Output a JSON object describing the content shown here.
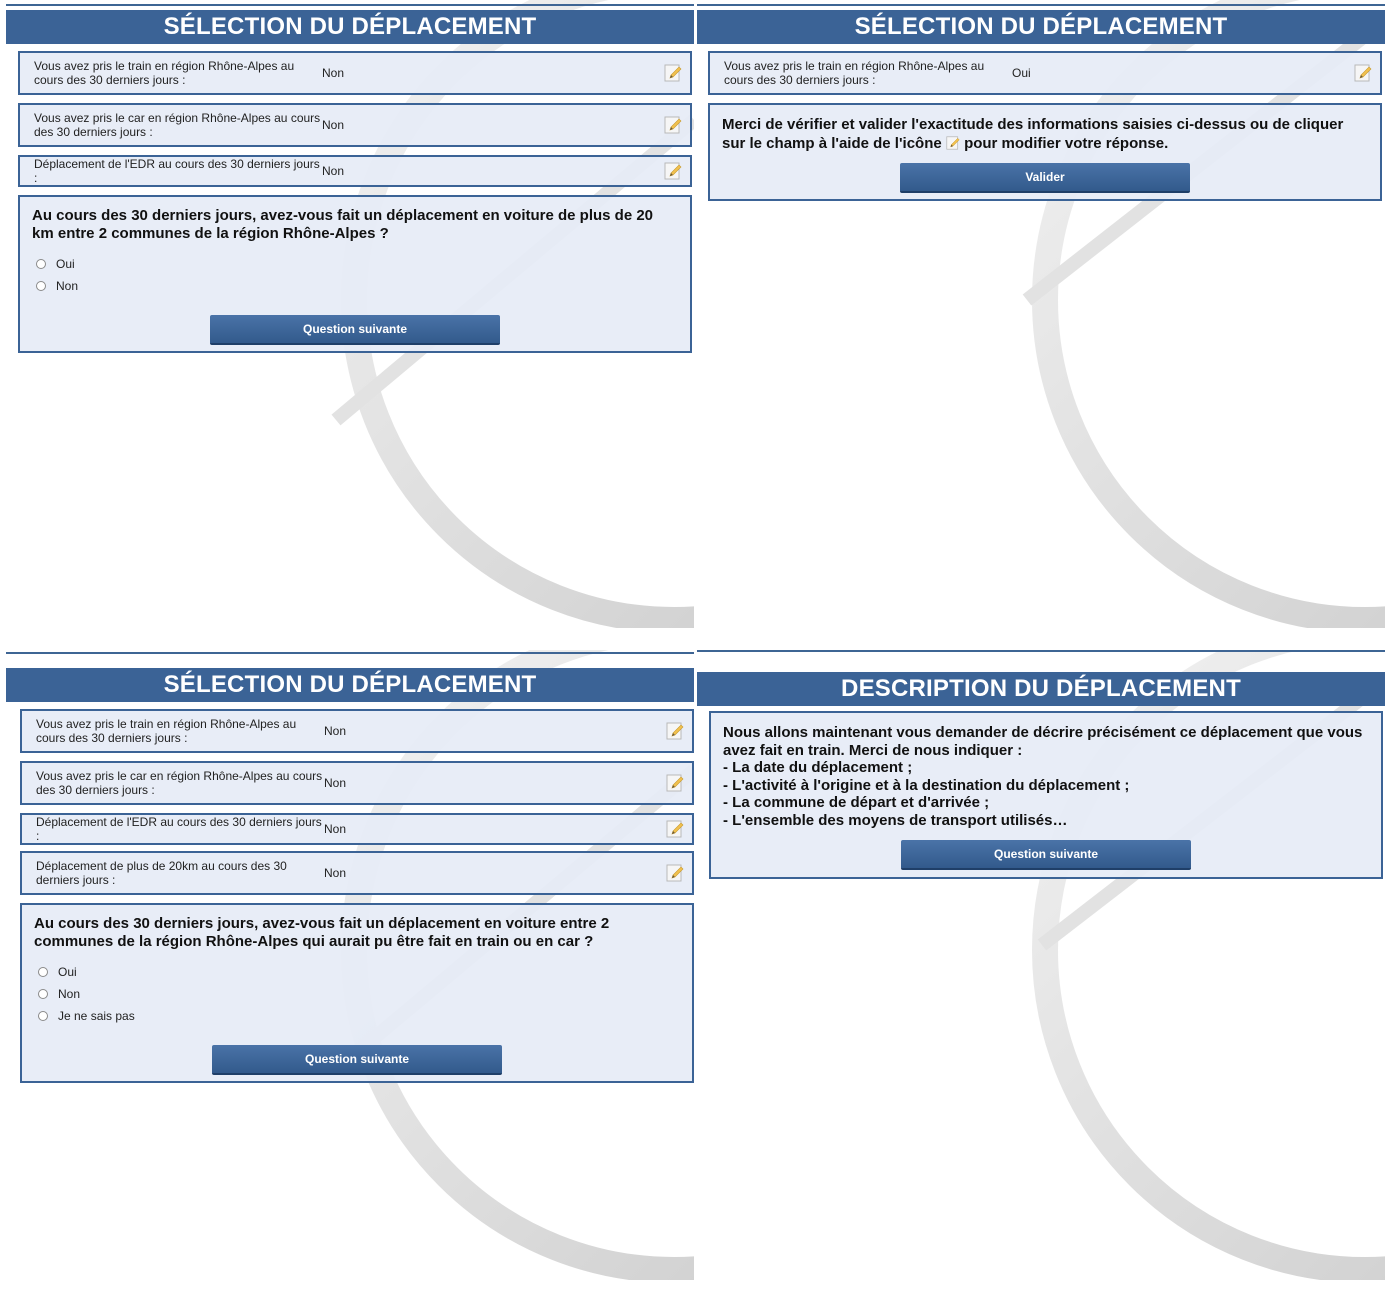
{
  "icons": {
    "edit": "pencil-edit-icon",
    "radio": "radio-button-icon"
  },
  "colors": {
    "header_bg": "#3b6396",
    "box_bg": "#e6ecf6",
    "button_bg": "#3e6799",
    "header_text": "#ffffff"
  },
  "panel1": {
    "title": "SÉLECTION DU DÉPLACEMENT",
    "rows": [
      {
        "label": "Vous avez pris le train en région Rhône-Alpes au cours des 30 derniers jours :",
        "value": "Non"
      },
      {
        "label": "Vous avez pris le car en région Rhône-Alpes au cours des 30 derniers jours :",
        "value": "Non"
      },
      {
        "label": "Déplacement de l'EDR au cours des 30 derniers jours :",
        "value": "Non"
      }
    ],
    "question": "Au cours des 30 derniers jours, avez-vous fait un déplacement en voiture de plus de 20 km entre 2 communes de la région Rhône-Alpes ?",
    "options": [
      "Oui",
      "Non"
    ],
    "button": "Question suivante"
  },
  "panel2": {
    "title": "SÉLECTION DU DÉPLACEMENT",
    "rows": [
      {
        "label": "Vous avez pris le train en région Rhône-Alpes au cours des 30 derniers jours :",
        "value": "Oui"
      }
    ],
    "notice_before_icon": "Merci de vérifier et valider l'exactitude des informations saisies ci-dessus ou de cliquer sur le champ à l'aide de l'icône",
    "notice_after_icon": "pour modifier votre réponse.",
    "button": "Valider"
  },
  "panel3": {
    "title": "SÉLECTION DU DÉPLACEMENT",
    "rows": [
      {
        "label": "Vous avez pris le train en région Rhône-Alpes au cours des 30 derniers jours :",
        "value": "Non"
      },
      {
        "label": "Vous avez pris le car en région Rhône-Alpes au cours des 30 derniers jours :",
        "value": "Non"
      },
      {
        "label": "Déplacement de l'EDR au cours des 30 derniers jours :",
        "value": "Non"
      },
      {
        "label": "Déplacement de plus de 20km au cours des 30 derniers jours :",
        "value": "Non"
      }
    ],
    "question": "Au cours des 30 derniers jours, avez-vous fait un déplacement en voiture entre 2 communes de la région Rhône-Alpes qui aurait pu être fait en train ou en car ?",
    "options": [
      "Oui",
      "Non",
      "Je ne sais pas"
    ],
    "button": "Question suivante"
  },
  "panel4": {
    "title": "DESCRIPTION DU DÉPLACEMENT",
    "intro": "Nous allons maintenant vous demander de décrire précisément ce déplacement que vous avez fait en train. Merci de nous indiquer :",
    "items": [
      "- La date du déplacement ;",
      "- L'activité à l'origine et à la destination du déplacement ;",
      "- La commune de départ et d'arrivée ;",
      "- L'ensemble des moyens de transport utilisés…"
    ],
    "button": "Question suivante"
  }
}
